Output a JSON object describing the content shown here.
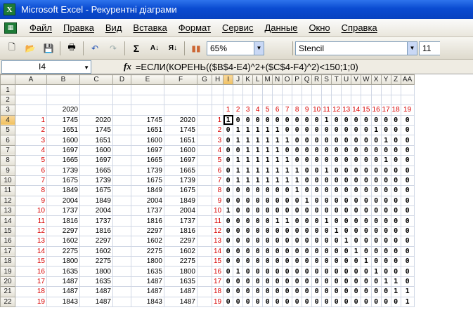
{
  "window": {
    "title": "Microsoft Excel - Рекурентні діаграми",
    "app_icon": "X"
  },
  "menu": [
    "Файл",
    "Правка",
    "Вид",
    "Вставка",
    "Формат",
    "Сервис",
    "Данные",
    "Окно",
    "Справка"
  ],
  "toolbar": {
    "zoom": "65%",
    "font": "Stencil",
    "font_size": "11",
    "sum_label": "Σ"
  },
  "formula_bar": {
    "name_box": "I4",
    "fx": "fx",
    "formula": "=ЕСЛИ(КОРЕНЬ(($B$4-E4)^2+($C$4-F4)^2)<150;1;0)"
  },
  "columns": [
    "A",
    "B",
    "C",
    "D",
    "E",
    "F",
    "G",
    "H",
    "I",
    "J",
    "K",
    "L",
    "M",
    "N",
    "O",
    "P",
    "Q",
    "R",
    "S",
    "T",
    "U",
    "V",
    "W",
    "X",
    "Y",
    "Z",
    "AA"
  ],
  "rows": [
    {
      "n": "1",
      "a": "",
      "b": "",
      "c": "",
      "e": "",
      "f": "",
      "h": ""
    },
    {
      "n": "2",
      "a": "",
      "b": "",
      "c": "",
      "e": "",
      "f": "",
      "h": ""
    },
    {
      "n": "3",
      "a": "",
      "b": "2020",
      "c": "",
      "e": "",
      "f": "",
      "h": ""
    },
    {
      "n": "4",
      "a": "1",
      "b": "1745",
      "c": "2020",
      "e": "1745",
      "f": "2020",
      "h": "1"
    },
    {
      "n": "5",
      "a": "2",
      "b": "1651",
      "c": "1745",
      "e": "1651",
      "f": "1745",
      "h": "2"
    },
    {
      "n": "6",
      "a": "3",
      "b": "1600",
      "c": "1651",
      "e": "1600",
      "f": "1651",
      "h": "3"
    },
    {
      "n": "7",
      "a": "4",
      "b": "1697",
      "c": "1600",
      "e": "1697",
      "f": "1600",
      "h": "4"
    },
    {
      "n": "8",
      "a": "5",
      "b": "1665",
      "c": "1697",
      "e": "1665",
      "f": "1697",
      "h": "5"
    },
    {
      "n": "9",
      "a": "6",
      "b": "1739",
      "c": "1665",
      "e": "1739",
      "f": "1665",
      "h": "6"
    },
    {
      "n": "10",
      "a": "7",
      "b": "1675",
      "c": "1739",
      "e": "1675",
      "f": "1739",
      "h": "7"
    },
    {
      "n": "11",
      "a": "8",
      "b": "1849",
      "c": "1675",
      "e": "1849",
      "f": "1675",
      "h": "8"
    },
    {
      "n": "12",
      "a": "9",
      "b": "2004",
      "c": "1849",
      "e": "2004",
      "f": "1849",
      "h": "9"
    },
    {
      "n": "13",
      "a": "10",
      "b": "1737",
      "c": "2004",
      "e": "1737",
      "f": "2004",
      "h": "10"
    },
    {
      "n": "14",
      "a": "11",
      "b": "1816",
      "c": "1737",
      "e": "1816",
      "f": "1737",
      "h": "11"
    },
    {
      "n": "15",
      "a": "12",
      "b": "2297",
      "c": "1816",
      "e": "2297",
      "f": "1816",
      "h": "12"
    },
    {
      "n": "16",
      "a": "13",
      "b": "1602",
      "c": "2297",
      "e": "1602",
      "f": "2297",
      "h": "13"
    },
    {
      "n": "17",
      "a": "14",
      "b": "2275",
      "c": "1602",
      "e": "2275",
      "f": "1602",
      "h": "14"
    },
    {
      "n": "18",
      "a": "15",
      "b": "1800",
      "c": "2275",
      "e": "1800",
      "f": "2275",
      "h": "15"
    },
    {
      "n": "19",
      "a": "16",
      "b": "1635",
      "c": "1800",
      "e": "1635",
      "f": "1800",
      "h": "16"
    },
    {
      "n": "20",
      "a": "17",
      "b": "1487",
      "c": "1635",
      "e": "1487",
      "f": "1635",
      "h": "17"
    },
    {
      "n": "21",
      "a": "18",
      "b": "1487",
      "c": "1487",
      "e": "1487",
      "f": "1487",
      "h": "18"
    },
    {
      "n": "22",
      "a": "19",
      "b": "1843",
      "c": "1487",
      "e": "1843",
      "f": "1487",
      "h": "19"
    }
  ],
  "matrix_header": [
    "1",
    "2",
    "3",
    "4",
    "5",
    "6",
    "7",
    "8",
    "9",
    "10",
    "11",
    "12",
    "13",
    "14",
    "15",
    "16",
    "17",
    "18",
    "19"
  ],
  "matrix": [
    "1000000000100000000",
    "0111110000000001000",
    "0111111000000000100",
    "0011110000000000000",
    "0111111000000000100",
    "0111111100100000000",
    "0111111100000000000",
    "0000000100000000000",
    "0000000010000000000",
    "1000000000000000000",
    "0000011000100000000",
    "0000000000010000000",
    "0000000000001000000",
    "0000000000000100000",
    "0000000000000010000",
    "0100000000000001000",
    "0000000000000000110",
    "0000000000000000011",
    "0000000000000000001"
  ]
}
